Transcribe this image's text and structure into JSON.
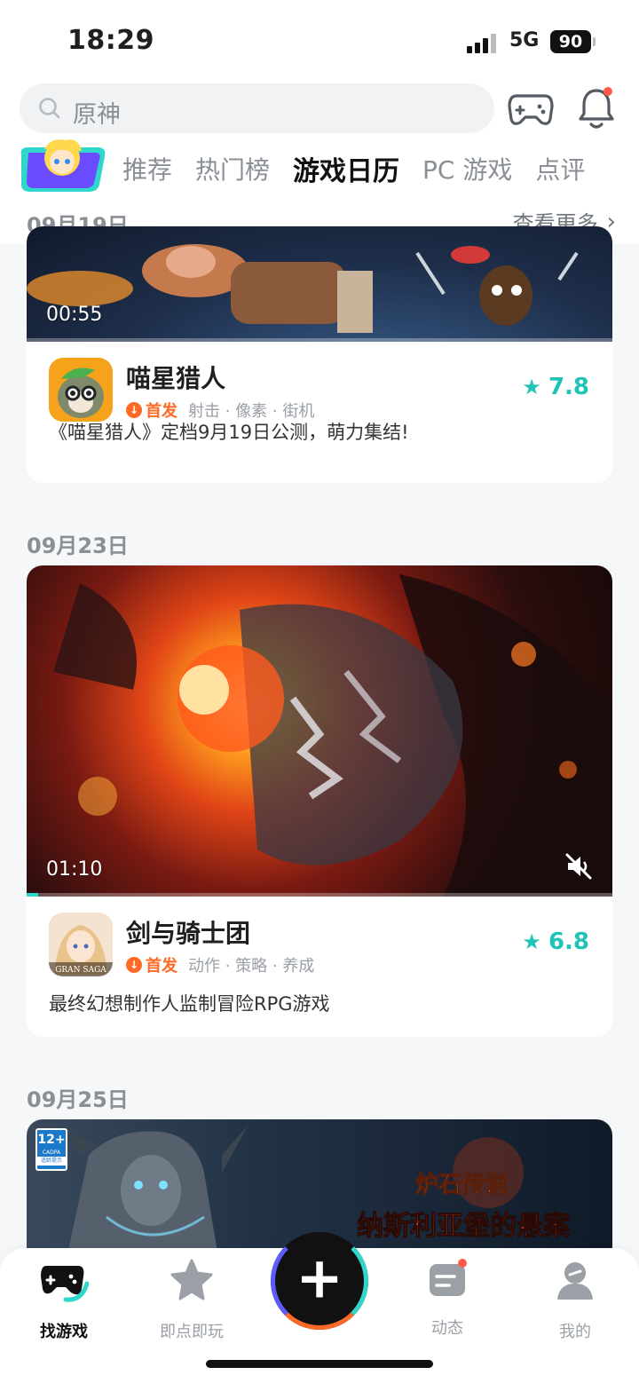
{
  "status_bar": {
    "time": "18:29",
    "network": "5G",
    "battery": "90"
  },
  "header": {
    "search_placeholder": "原神",
    "tabs": [
      {
        "label": "推荐",
        "active": false
      },
      {
        "label": "热门榜",
        "active": false
      },
      {
        "label": "游戏日历",
        "active": true
      },
      {
        "label": "PC 游戏",
        "active": false
      },
      {
        "label": "点评",
        "active": false
      }
    ],
    "sticky_date": "09月19日",
    "more_label": "查看更多"
  },
  "feed": [
    {
      "date": "09月19日",
      "duration": "00:55",
      "progress": 1.0,
      "name": "喵星猎人",
      "badge": "首发",
      "tags": "射击 · 像素 · 街机",
      "rating": "7.8",
      "desc": "《喵星猎人》定档9月19日公测，萌力集结!"
    },
    {
      "date": "09月23日",
      "duration": "01:10",
      "progress": 0.0,
      "name": "剑与骑士团",
      "badge": "首发",
      "tags": "动作 · 策略 · 养成",
      "rating": "6.8",
      "desc": "最终幻想制作人监制冒险RPG游戏",
      "icon_text": "GRAN SAGA"
    },
    {
      "date": "09月25日",
      "age_rating": "12+",
      "age_rating_org": "CADPA",
      "age_rating_note": "适龄提示",
      "banner_title_1": "炉石传说",
      "banner_title_2": "纳斯利亚堡的悬案"
    }
  ],
  "bottom_nav": [
    {
      "label": "找游戏",
      "active": true
    },
    {
      "label": "即点即玩",
      "active": false
    },
    {
      "label": "动态",
      "active": false
    },
    {
      "label": "我的",
      "active": false
    }
  ],
  "colors": {
    "accent": "#2ed7c9",
    "orange": "#ff6a26",
    "red_dot": "#ff5b4a"
  }
}
